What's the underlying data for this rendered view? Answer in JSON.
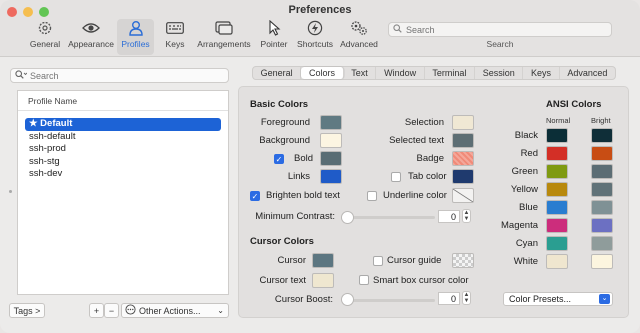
{
  "window": {
    "title": "Preferences"
  },
  "toolbar": {
    "items": [
      {
        "label": "General",
        "icon": "gear-icon"
      },
      {
        "label": "Appearance",
        "icon": "eye-icon"
      },
      {
        "label": "Profiles",
        "icon": "person-icon",
        "active": true
      },
      {
        "label": "Keys",
        "icon": "keyboard-icon"
      },
      {
        "label": "Arrangements",
        "icon": "window-stack-icon"
      },
      {
        "label": "Pointer",
        "icon": "pointer-icon"
      },
      {
        "label": "Shortcuts",
        "icon": "bolt-icon"
      },
      {
        "label": "Advanced",
        "icon": "gears-icon"
      }
    ],
    "search_placeholder": "Search",
    "search_label": "Search"
  },
  "left": {
    "search_placeholder": "Search",
    "list_header": "Profile Name",
    "profiles": [
      "Default",
      "ssh-default",
      "ssh-prod",
      "ssh-stg",
      "ssh-dev"
    ],
    "tags_label": "Tags >",
    "plus": "+",
    "minus": "−",
    "other_actions": "Other Actions..."
  },
  "tabs": [
    "General",
    "Colors",
    "Text",
    "Window",
    "Terminal",
    "Session",
    "Keys",
    "Advanced"
  ],
  "active_tab": "Colors",
  "basic": {
    "title": "Basic Colors",
    "foreground": "Foreground",
    "background": "Background",
    "bold": "Bold",
    "links": "Links",
    "brighten": "Brighten bold text",
    "selection": "Selection",
    "selected_text": "Selected text",
    "badge": "Badge",
    "tab_color": "Tab color",
    "underline_color": "Underline color",
    "min_contrast": "Minimum Contrast:",
    "min_contrast_value": "0"
  },
  "cursor": {
    "title": "Cursor Colors",
    "cursor": "Cursor",
    "cursor_text": "Cursor text",
    "cursor_guide": "Cursor guide",
    "smart_box": "Smart box cursor color",
    "boost": "Cursor Boost:",
    "boost_value": "0"
  },
  "ansi": {
    "title": "ANSI Colors",
    "normal": "Normal",
    "bright": "Bright",
    "rows": [
      "Black",
      "Red",
      "Green",
      "Yellow",
      "Blue",
      "Magenta",
      "Cyan",
      "White"
    ],
    "normal_colors": [
      "#0b2e37",
      "#d32f26",
      "#7f9a11",
      "#b8890d",
      "#2a7dd0",
      "#cc2d7c",
      "#2a9e91",
      "#efe6cf"
    ],
    "bright_colors": [
      "#0f2e38",
      "#c84d14",
      "#5c6d74",
      "#607278",
      "#7f9195",
      "#6c70c2",
      "#8f9c9b",
      "#fcf5df"
    ]
  },
  "presets_label": "Color Presets...",
  "colors": {
    "foreground": "#607a82",
    "background": "#fcf5e2",
    "bold": "#596d74",
    "links": "#1f5bc8",
    "selection": "#f0e8d4",
    "selected_text": "#5d6e74",
    "badge": "#f08a78",
    "tab_color": "#1f3a6e",
    "cursor": "#5c7681",
    "cursor_text": "#efe7d0"
  }
}
